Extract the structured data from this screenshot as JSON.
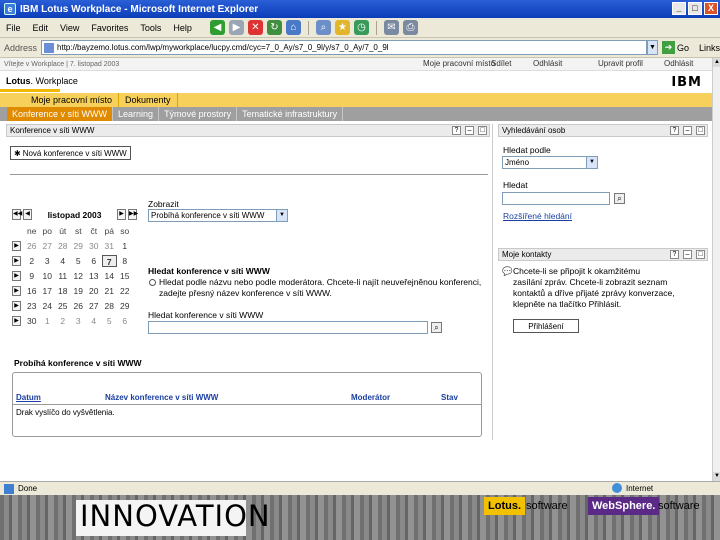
{
  "window": {
    "title": "IBM Lotus Workplace - Microsoft Internet Explorer",
    "buttons": {
      "minimize": "_",
      "maximize": "□",
      "close": "X"
    }
  },
  "menubar": {
    "items": [
      "File",
      "Edit",
      "View",
      "Favorites",
      "Tools",
      "Help"
    ],
    "links_label": "Links"
  },
  "address": {
    "label": "Address",
    "url": "http://bayzemo.lotus.com/lwp/myworkplace/lucpy.cmd/cyc=7_0_Ay/s7_0_9l/y/s7_0_Ay/7_0_9l",
    "go_label": "Go"
  },
  "portal": {
    "path": "Vítejte v Workplace | 7. listopad 2003",
    "top_links": [
      "Moje pracovní místo",
      "Sdílet",
      "Odhlásit"
    ],
    "top_links2": [
      "Upravit profil",
      "Odhlásit"
    ],
    "brand_lotus": "Lotus",
    "brand_workplace": "Workplace",
    "ibm": "IBM",
    "tabs1": [
      "Moje pracovní místo",
      "Dokumenty"
    ],
    "tabs2": [
      "Konference v síti WWW",
      "Learning",
      "Týmové prostory",
      "Tematické infrastruktury"
    ]
  },
  "conference": {
    "title": "Konference v síti WWW",
    "new_button": "Nová konference v síti WWW",
    "calendar": {
      "month": "listopad 2003",
      "weekdays": [
        "ne",
        "po",
        "út",
        "st",
        "čt",
        "pá",
        "so"
      ],
      "weeks": [
        [
          "26",
          "27",
          "28",
          "29",
          "30",
          "31",
          "1"
        ],
        [
          "2",
          "3",
          "4",
          "5",
          "6",
          "7",
          "8"
        ],
        [
          "9",
          "10",
          "11",
          "12",
          "13",
          "14",
          "15"
        ],
        [
          "16",
          "17",
          "18",
          "19",
          "20",
          "21",
          "22"
        ],
        [
          "23",
          "24",
          "25",
          "26",
          "27",
          "28",
          "29"
        ],
        [
          "30",
          "1",
          "2",
          "3",
          "4",
          "5",
          "6"
        ]
      ],
      "today": "7"
    },
    "show_label": "Zobrazit",
    "show_value": "Probíhá konference v síti WWW",
    "search_heading": "Hledat konference v síti WWW",
    "search_help_1": "Hledat podle názvu nebo podle moderátora. Chcete-li najít neuveřejněnou konferenci,",
    "search_help_2": "zadejte přesný název konference v síti WWW.",
    "search_field_label": "Hledat konference v síti WWW",
    "results_heading": "Probíhá konference v síti WWW",
    "columns": [
      "Datum",
      "Název konference v síti WWW",
      "Moderátor",
      "Stav"
    ],
    "empty_text": "Drak vyslíčo do vyšvětlenia."
  },
  "people_search": {
    "title": "Vyhledávání osob",
    "search_by_label": "Hledat podle",
    "search_by_value": "Jméno",
    "search_label": "Hledat",
    "advanced_link": "Rozšířené hledání"
  },
  "contacts": {
    "title": "Moje kontakty",
    "message_1": "Chcete-li se připojit k okamžitému",
    "message_2": "zasílání zpráv. Chcete-li zobrazit seznam",
    "message_3": "kontaktů a dříve přijaté zprávy konverzace,",
    "message_4": "klepněte na tlačítko Přihlásit.",
    "login_button": "Přihlášení"
  },
  "statusbar": {
    "status": "Done",
    "zone": "Internet"
  },
  "banner": {
    "innovation": "INNOVATION",
    "lotus": "Lotus.",
    "lotus_software": "software",
    "websphere": "WebSphere.",
    "websphere_software": "software"
  },
  "colors": {
    "tab_yellow": "#f6d05a",
    "tab_orange": "#e8a200",
    "tab_grey": "#9f9f9f",
    "link_blue": "#1a3fa0",
    "xp_title_blue": "#0b3db8"
  }
}
